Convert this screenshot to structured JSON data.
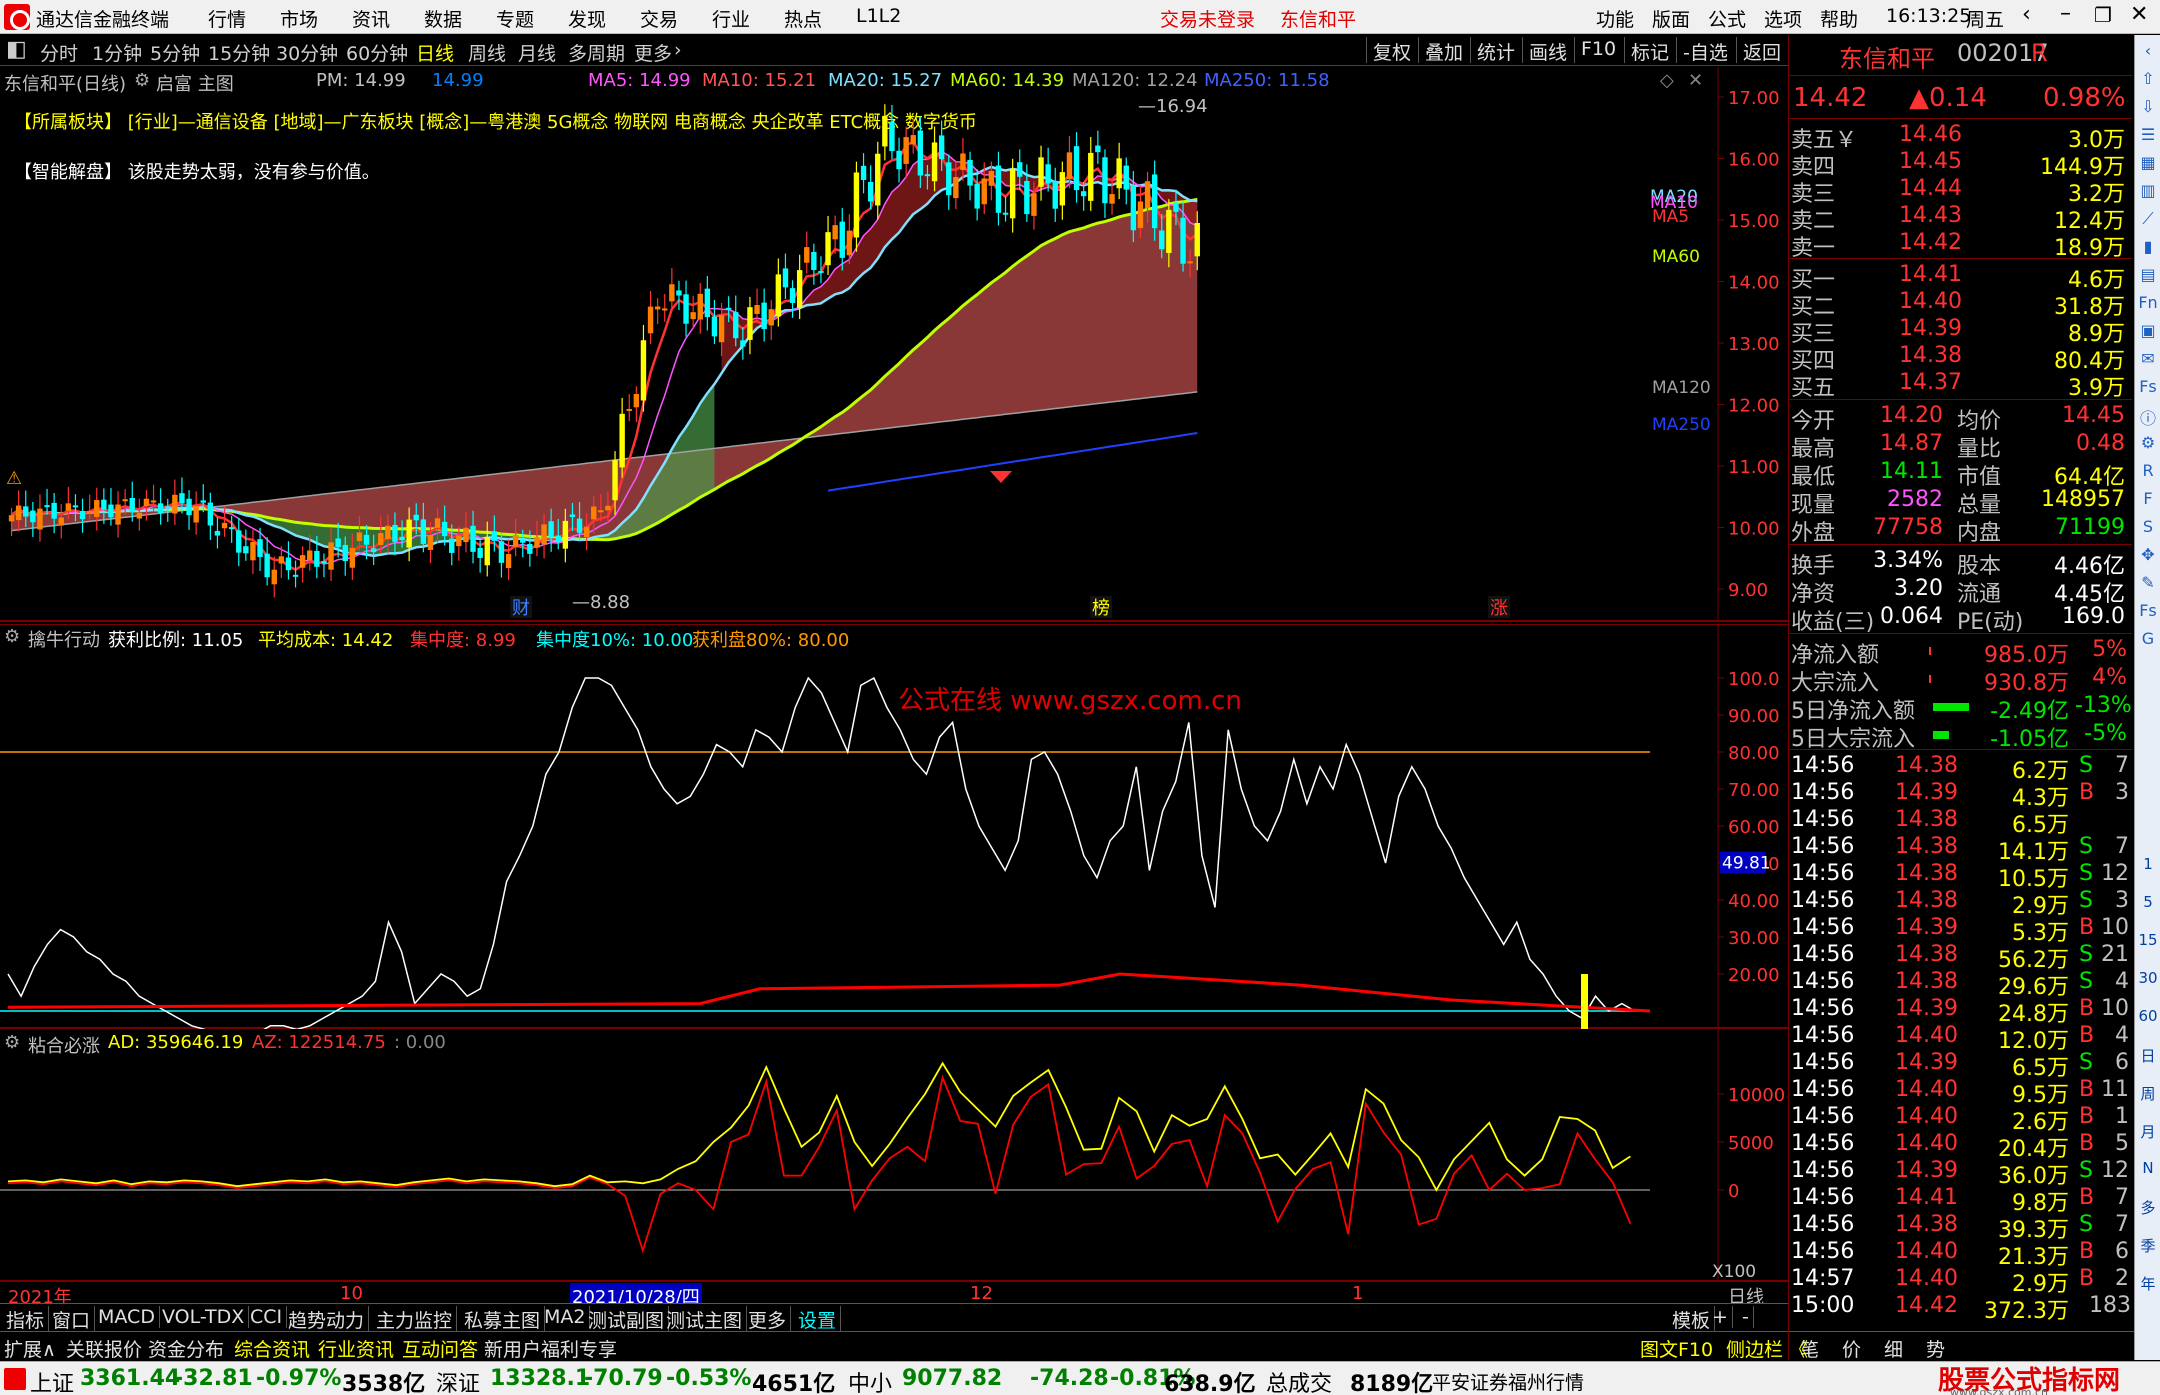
{
  "titlebar": {
    "app_name": "通达信金融终端",
    "menus": [
      "行情",
      "市场",
      "资讯",
      "数据",
      "专题",
      "发现",
      "交易",
      "行业",
      "热点",
      "L1L2"
    ],
    "login_status": "交易未登录",
    "stock_name": "东信和平",
    "right_menus": [
      "功能",
      "版面",
      "公式",
      "选项",
      "帮助"
    ],
    "time": "16:13:25",
    "weekday": "周五"
  },
  "periodbar": {
    "periods": [
      "分时",
      "1分钟",
      "5分钟",
      "15分钟",
      "30分钟",
      "60分钟",
      "日线",
      "周线",
      "月线",
      "多周期",
      "更多"
    ],
    "selected": "日线",
    "tools": [
      "复权",
      "叠加",
      "统计",
      "画线",
      "F10",
      "标记",
      "-自选",
      "返回"
    ]
  },
  "main": {
    "header": {
      "title": "东信和平(日线)",
      "mode_label": "启富 主图",
      "pm": "PM: 14.99",
      "pm2": "14.99",
      "ma5": "MA5: 14.99",
      "ma10": "MA10: 15.21",
      "ma20": "MA20: 15.27",
      "ma60": "MA60: 14.39",
      "ma120": "MA120: 12.24",
      "ma250": "MA250: 11.58"
    },
    "sector_line": "【所属板块】  [行业]—通信设备    [地域]—广东板块    [概念]—粤港澳 5G概念 物联网 电商概念 央企改革 ETC概念 数字货币",
    "ai_line": "【智能解盘】   该股走势太弱，没有参与价值。",
    "price_axis": [
      "17.00",
      "16.00",
      "15.00",
      "14.00",
      "13.00",
      "12.00",
      "11.00",
      "10.00",
      "9.00"
    ],
    "high_label": "16.94",
    "low_label": "8.88",
    "ma_labels": [
      "MA20",
      "MA10",
      "MA5",
      "MA60",
      "MA120",
      "MA250"
    ],
    "markers": [
      "财",
      "榜",
      "涨"
    ]
  },
  "panel2": {
    "name": "擒牛行动",
    "v1": "获利比例: 11.05",
    "v2": "平均成本: 14.42",
    "v3": "集中度: 8.99",
    "v4": "集中度10%: 10.00",
    "v5": "获利盘80%: 80.00",
    "axis": [
      "100.0",
      "90.00",
      "80.00",
      "70.00",
      "60.00",
      "50.00",
      "40.00",
      "30.00",
      "20.00"
    ],
    "current": "49.81",
    "watermark": "公式在线  www.gszx.com.cn"
  },
  "panel3": {
    "name": "粘合必涨",
    "ad": "AD: 359646.19",
    "az": "AZ: 122514.75",
    "z": ": 0.00",
    "axis": [
      "10000",
      "5000",
      "0"
    ],
    "unit": "X100"
  },
  "xaxis": {
    "labels": [
      "2021年",
      "10",
      "2021/10/28/四",
      "12",
      "1"
    ],
    "period": "日线"
  },
  "bottomtabs": [
    "指标",
    "窗口",
    "MACD",
    "VOL-TDX",
    "CCI",
    "趋势动力",
    "主力监控",
    "私募主图",
    "MA2",
    "测试副图",
    "测试主图",
    "更多",
    "设置",
    "模板",
    "+",
    "-"
  ],
  "extbar": [
    "扩展∧",
    "关联报价",
    "资金分布",
    "综合资讯",
    "行业资讯",
    "互动问答",
    "新用户福利专享"
  ],
  "extbar_right": [
    "图文F10",
    "侧边栏 《",
    "笔",
    "价",
    "细",
    "势"
  ],
  "quote": {
    "name": "东信和平",
    "code": "002017",
    "suffix": "R",
    "price": "14.42",
    "change": "▲0.14",
    "pct": "0.98%",
    "asks": [
      [
        "卖五￥",
        "14.46",
        "3.0万"
      ],
      [
        "卖四",
        "14.45",
        "144.9万"
      ],
      [
        "卖三",
        "14.44",
        "3.2万"
      ],
      [
        "卖二",
        "14.43",
        "12.4万"
      ],
      [
        "卖一",
        "14.42",
        "18.9万"
      ]
    ],
    "bids": [
      [
        "买一",
        "14.41",
        "4.6万"
      ],
      [
        "买二",
        "14.40",
        "31.8万"
      ],
      [
        "买三",
        "14.39",
        "8.9万"
      ],
      [
        "买四",
        "14.38",
        "80.4万"
      ],
      [
        "买五",
        "14.37",
        "3.9万"
      ]
    ],
    "stats": [
      [
        "今开",
        "14.20",
        "均价",
        "14.45"
      ],
      [
        "最高",
        "14.87",
        "量比",
        "0.48"
      ],
      [
        "最低",
        "14.11",
        "市值",
        "64.4亿"
      ],
      [
        "现量",
        "2582",
        "总量",
        "148957"
      ],
      [
        "外盘",
        "77758",
        "内盘",
        "71199"
      ]
    ],
    "stats2": [
      [
        "换手",
        "3.34%",
        "股本",
        "4.46亿"
      ],
      [
        "净资",
        "3.20",
        "流通",
        "4.45亿"
      ],
      [
        "收益(三)",
        "0.064",
        "PE(动)",
        "169.0"
      ]
    ],
    "flows": [
      [
        "净流入额",
        "985.0万",
        "5%"
      ],
      [
        "大宗流入",
        "930.8万",
        "4%"
      ],
      [
        "5日净流入额",
        "-2.49亿",
        "-13%"
      ],
      [
        "5日大宗流入",
        "-1.05亿",
        "-5%"
      ]
    ],
    "ticks": [
      [
        "14:56",
        "14.38",
        "6.2万",
        "S",
        "7"
      ],
      [
        "14:56",
        "14.39",
        "4.3万",
        "B",
        "3"
      ],
      [
        "14:56",
        "14.38",
        "6.5万",
        "",
        ""
      ],
      [
        "14:56",
        "14.38",
        "14.1万",
        "S",
        "7"
      ],
      [
        "14:56",
        "14.38",
        "10.5万",
        "S",
        "12"
      ],
      [
        "14:56",
        "14.38",
        "2.9万",
        "S",
        "3"
      ],
      [
        "14:56",
        "14.39",
        "5.3万",
        "B",
        "10"
      ],
      [
        "14:56",
        "14.38",
        "56.2万",
        "S",
        "21"
      ],
      [
        "14:56",
        "14.38",
        "29.6万",
        "S",
        "4"
      ],
      [
        "14:56",
        "14.39",
        "24.8万",
        "B",
        "10"
      ],
      [
        "14:56",
        "14.40",
        "12.0万",
        "B",
        "4"
      ],
      [
        "14:56",
        "14.39",
        "6.5万",
        "S",
        "6"
      ],
      [
        "14:56",
        "14.40",
        "9.5万",
        "B",
        "11"
      ],
      [
        "14:56",
        "14.40",
        "2.6万",
        "B",
        "1"
      ],
      [
        "14:56",
        "14.40",
        "20.4万",
        "B",
        "5"
      ],
      [
        "14:56",
        "14.39",
        "36.0万",
        "S",
        "12"
      ],
      [
        "14:56",
        "14.41",
        "9.8万",
        "B",
        "7"
      ],
      [
        "14:56",
        "14.38",
        "39.3万",
        "S",
        "7"
      ],
      [
        "14:56",
        "14.40",
        "21.3万",
        "B",
        "6"
      ],
      [
        "14:57",
        "14.40",
        "2.9万",
        "B",
        "2"
      ],
      [
        "15:00",
        "14.42",
        "372.3万",
        "",
        "183"
      ]
    ]
  },
  "rightbar": [
    "RSI",
    "Fin",
    "S",
    "1",
    "5",
    "15",
    "30",
    "60",
    "日",
    "周",
    "月",
    "N",
    "多",
    "季",
    "年"
  ],
  "statusbar": {
    "sh_name": "上证",
    "sh_val": "3361.44",
    "sh_chg": "-32.81",
    "sh_pct": "-0.97%",
    "sh_amt": "3538亿",
    "sz_name": "深证",
    "sz_val": "13328.1",
    "sz_chg": "-70.79",
    "sz_pct": "-0.53%",
    "sz_amt": "4651亿",
    "zx_name": "中小",
    "zx_val": "9077.82",
    "zx_chg": "-74.28",
    "zx_pct": "-0.81%",
    "zx_amt": "638.9亿",
    "total_label": "总成交",
    "total": "8189亿",
    "broker": "平安证券福州行情",
    "brand": "股票公式指标网",
    "brand_url": "www.gszx.com.cn"
  },
  "colors": {
    "up": "#ff3232",
    "down": "#00ffff",
    "yellow": "#ffff00",
    "ma60": "#bfff00",
    "axisline": "#7a0000"
  }
}
